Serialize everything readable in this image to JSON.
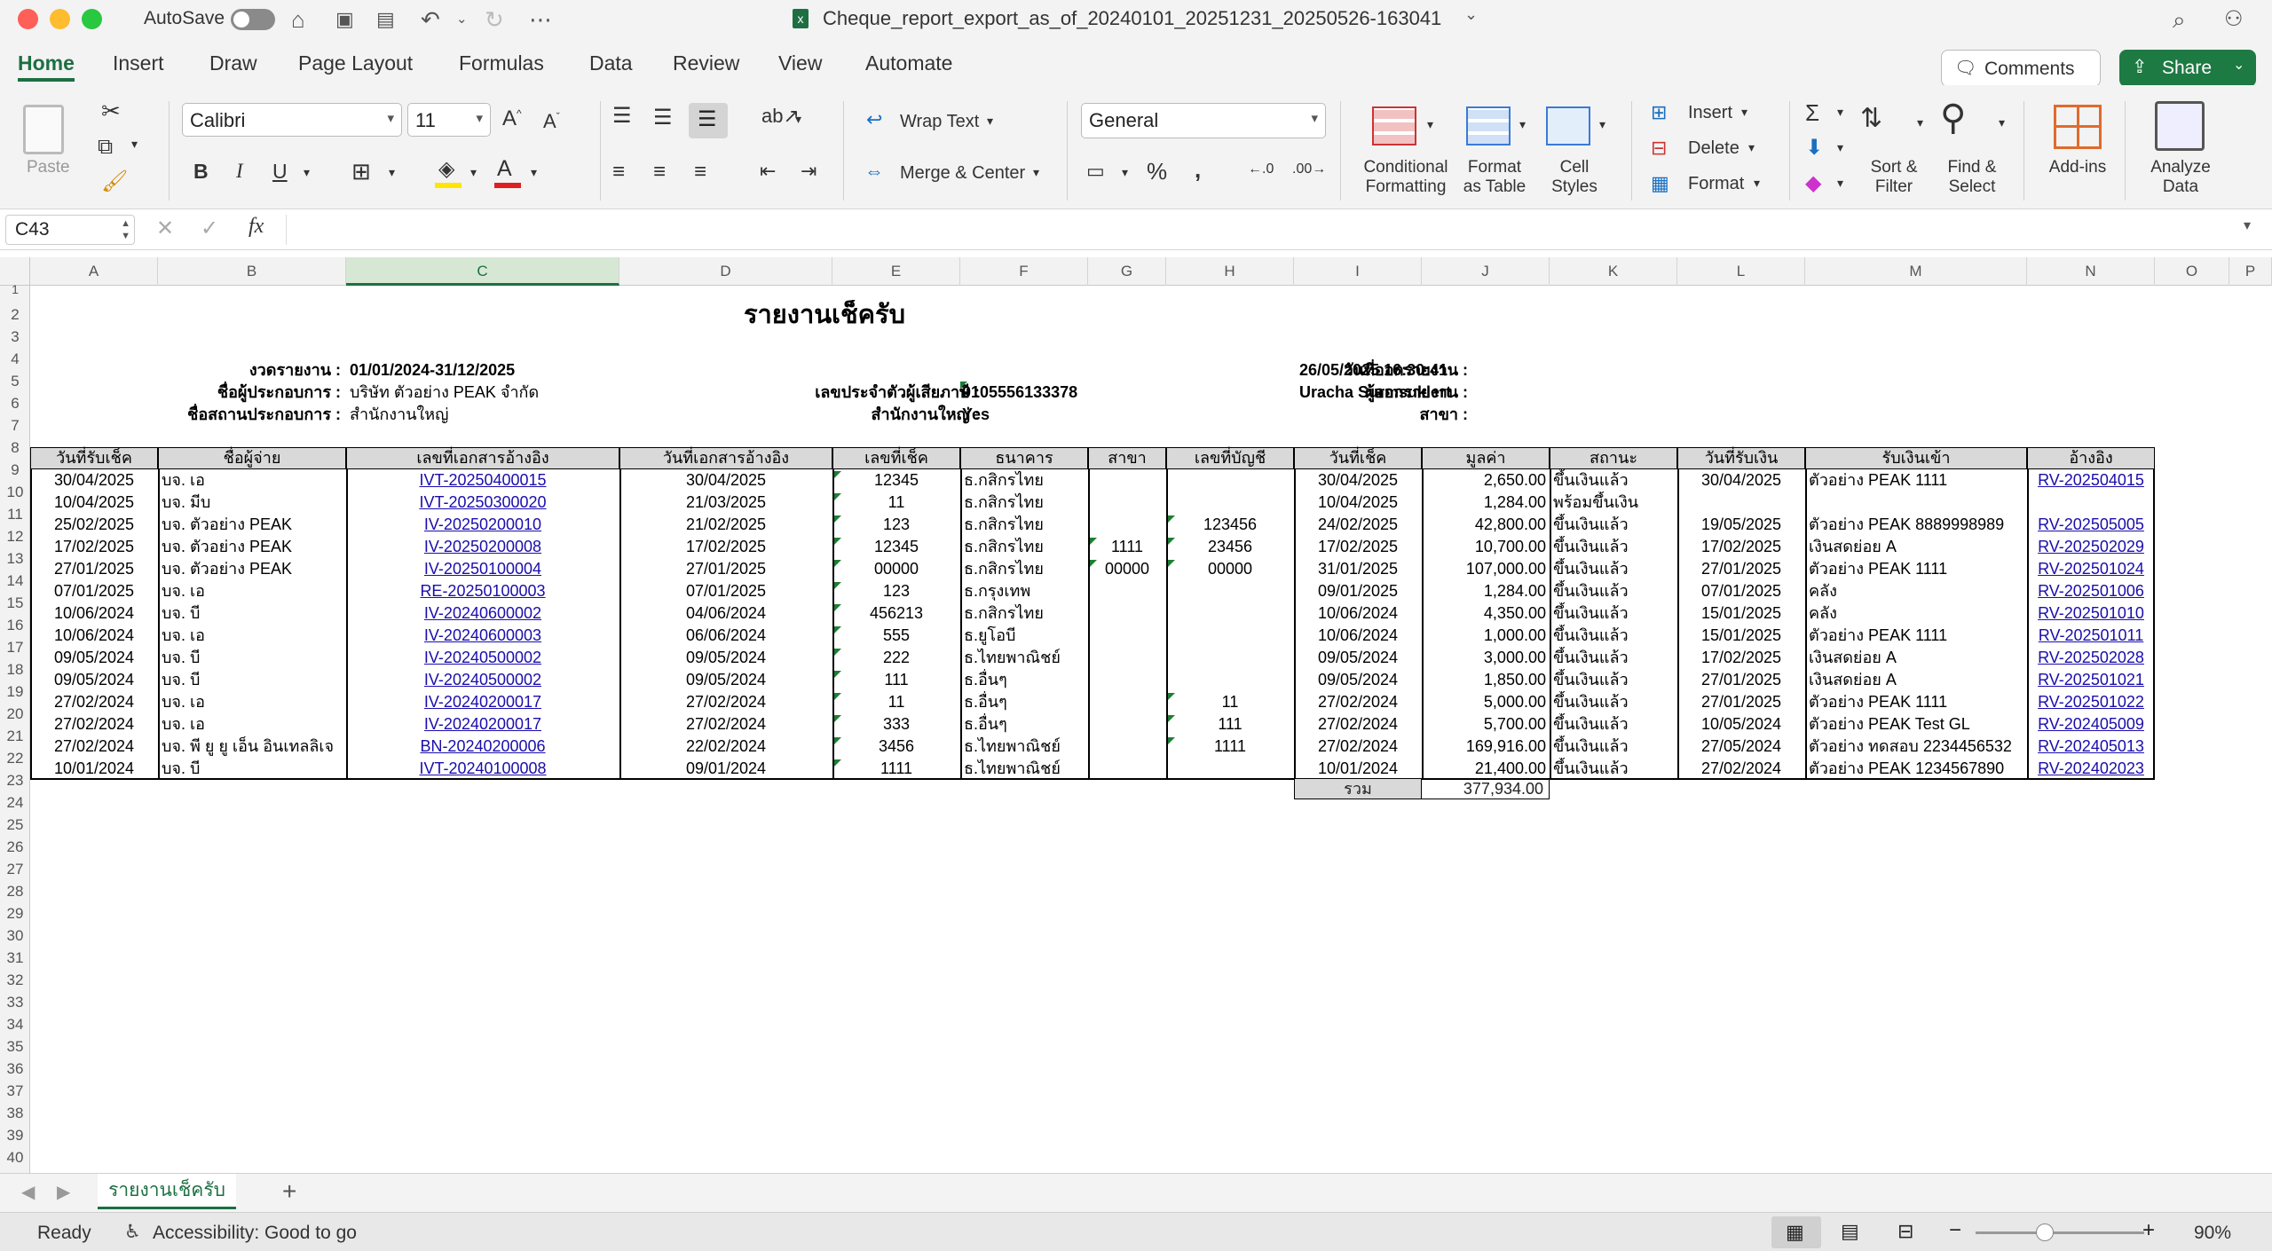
{
  "titlebar": {
    "autosave_label": "AutoSave",
    "filename": "Cheque_report_export_as_of_20240101_20251231_20250526-163041"
  },
  "tabs": [
    "Home",
    "Insert",
    "Draw",
    "Page Layout",
    "Formulas",
    "Data",
    "Review",
    "View",
    "Automate"
  ],
  "comments_label": "Comments",
  "share_label": "Share",
  "ribbon": {
    "paste": "Paste",
    "font_name": "Calibri",
    "font_size": "11",
    "wrap_text": "Wrap Text",
    "merge_center": "Merge & Center",
    "number_format": "General",
    "conditional_formatting": [
      "Conditional",
      "Formatting"
    ],
    "format_as_table": [
      "Format",
      "as Table"
    ],
    "cell_styles": [
      "Cell",
      "Styles"
    ],
    "insert": "Insert",
    "delete": "Delete",
    "format": "Format",
    "sort_filter": [
      "Sort &",
      "Filter"
    ],
    "find_select": [
      "Find &",
      "Select"
    ],
    "addins": "Add-ins",
    "analyze_data": [
      "Analyze",
      "Data"
    ]
  },
  "formula_bar": {
    "name_box": "C43",
    "fx": "fx",
    "formula": ""
  },
  "columns": [
    "A",
    "B",
    "C",
    "D",
    "E",
    "F",
    "G",
    "H",
    "I",
    "J",
    "K",
    "L",
    "M",
    "N",
    "O",
    "P"
  ],
  "rows": [
    "1",
    "2",
    "3",
    "4",
    "5",
    "6",
    "7",
    "8",
    "9",
    "10",
    "11",
    "12",
    "13",
    "14",
    "15",
    "16",
    "17",
    "18",
    "19",
    "20",
    "21",
    "22",
    "23",
    "24",
    "25",
    "26",
    "27",
    "28",
    "29",
    "30",
    "31",
    "32",
    "33",
    "34",
    "35",
    "36",
    "37",
    "38",
    "39",
    "40"
  ],
  "report": {
    "title": "รายงานเช็ครับ",
    "period_label": "งวดรายงาน :",
    "period_value": "01/01/2024-31/12/2025",
    "company_label": "ชื่อผู้ประกอบการ :",
    "company_value": "บริษัท ตัวอย่าง PEAK จำกัด",
    "branch_label": "ชื่อสถานประกอบการ :",
    "branch_value": "สำนักงานใหญ่",
    "taxid_label": "เลขประจำตัวผู้เสียภาษี :",
    "taxid_value": "0105556133378",
    "hq_label": "สำนักงานใหญ่ :",
    "hq_value": "Yes",
    "issue_date_label": "วันที่ออกรายงาน :",
    "issue_date_value": "26/05/2025 16:30:41",
    "issuer_label": "ผู้ออกรายงาน :",
    "issuer_value": "Uracha Surmsuklert",
    "branch2_label": "สาขา :"
  },
  "table_headers": [
    "วันที่รับเช็ค",
    "ชื่อผู้จ่าย",
    "เลขที่เอกสารอ้างอิง",
    "วันที่เอกสารอ้างอิง",
    "เลขที่เช็ค",
    "ธนาคาร",
    "สาขา",
    "เลขที่บัญชี",
    "วันที่เช็ค",
    "มูลค่า",
    "สถานะ",
    "วันที่รับเงิน",
    "รับเงินเข้า",
    "อ้างอิง"
  ],
  "table_rows": [
    [
      "30/04/2025",
      "บจ. เอ",
      "IVT-20250400015",
      "30/04/2025",
      "12345",
      "ธ.กสิกรไทย",
      "",
      "",
      "30/04/2025",
      "2,650.00",
      "ขึ้นเงินแล้ว",
      "30/04/2025",
      "ตัวอย่าง PEAK  1111",
      "RV-202504015"
    ],
    [
      "10/04/2025",
      "บจ. มีบ",
      "IVT-20250300020",
      "21/03/2025",
      "11",
      "ธ.กสิกรไทย",
      "",
      "",
      "10/04/2025",
      "1,284.00",
      "พร้อมขึ้นเงิน",
      "",
      "",
      ""
    ],
    [
      "25/02/2025",
      "บจ. ตัวอย่าง PEAK",
      "IV-20250200010",
      "21/02/2025",
      "123",
      "ธ.กสิกรไทย",
      "",
      "123456",
      "24/02/2025",
      "42,800.00",
      "ขึ้นเงินแล้ว",
      "19/05/2025",
      "ตัวอย่าง PEAK  8889998989",
      "RV-202505005"
    ],
    [
      "17/02/2025",
      "บจ. ตัวอย่าง PEAK",
      "IV-20250200008",
      "17/02/2025",
      "12345",
      "ธ.กสิกรไทย",
      "1111",
      "23456",
      "17/02/2025",
      "10,700.00",
      "ขึ้นเงินแล้ว",
      "17/02/2025",
      "เงินสดย่อย A",
      "RV-202502029"
    ],
    [
      "27/01/2025",
      "บจ. ตัวอย่าง PEAK",
      "IV-20250100004",
      "27/01/2025",
      "00000",
      "ธ.กสิกรไทย",
      "00000",
      "00000",
      "31/01/2025",
      "107,000.00",
      "ขึ้นเงินแล้ว",
      "27/01/2025",
      "ตัวอย่าง PEAK  1111",
      "RV-202501024"
    ],
    [
      "07/01/2025",
      "บจ. เอ",
      "RE-20250100003",
      "07/01/2025",
      "123",
      "ธ.กรุงเทพ",
      "",
      "",
      "09/01/2025",
      "1,284.00",
      "ขึ้นเงินแล้ว",
      "07/01/2025",
      "คลัง",
      "RV-202501006"
    ],
    [
      "10/06/2024",
      "บจ. บี",
      "IV-20240600002",
      "04/06/2024",
      "456213",
      "ธ.กสิกรไทย",
      "",
      "",
      "10/06/2024",
      "4,350.00",
      "ขึ้นเงินแล้ว",
      "15/01/2025",
      "คลัง",
      "RV-202501010"
    ],
    [
      "10/06/2024",
      "บจ. เอ",
      "IV-20240600003",
      "06/06/2024",
      "555",
      "ธ.ยูโอบี",
      "",
      "",
      "10/06/2024",
      "1,000.00",
      "ขึ้นเงินแล้ว",
      "15/01/2025",
      "ตัวอย่าง PEAK  1111",
      "RV-202501011"
    ],
    [
      "09/05/2024",
      "บจ. บี",
      "IV-20240500002",
      "09/05/2024",
      "222",
      "ธ.ไทยพาณิชย์",
      "",
      "",
      "09/05/2024",
      "3,000.00",
      "ขึ้นเงินแล้ว",
      "17/02/2025",
      "เงินสดย่อย A",
      "RV-202502028"
    ],
    [
      "09/05/2024",
      "บจ. บี",
      "IV-20240500002",
      "09/05/2024",
      "111",
      "ธ.อื่นๆ",
      "",
      "",
      "09/05/2024",
      "1,850.00",
      "ขึ้นเงินแล้ว",
      "27/01/2025",
      "เงินสดย่อย A",
      "RV-202501021"
    ],
    [
      "27/02/2024",
      "บจ. เอ",
      "IV-20240200017",
      "27/02/2024",
      "11",
      "ธ.อื่นๆ",
      "",
      "11",
      "27/02/2024",
      "5,000.00",
      "ขึ้นเงินแล้ว",
      "27/01/2025",
      "ตัวอย่าง PEAK  1111",
      "RV-202501022"
    ],
    [
      "27/02/2024",
      "บจ. เอ",
      "IV-20240200017",
      "27/02/2024",
      "333",
      "ธ.อื่นๆ",
      "",
      "111",
      "27/02/2024",
      "5,700.00",
      "ขึ้นเงินแล้ว",
      "10/05/2024",
      "ตัวอย่าง PEAK  Test GL",
      "RV-202405009"
    ],
    [
      "27/02/2024",
      "บจ. พี ยู ยู เอ็น อินเทลลิเจ",
      "BN-20240200006",
      "22/02/2024",
      "3456",
      "ธ.ไทยพาณิชย์",
      "",
      "1111",
      "27/02/2024",
      "169,916.00",
      "ขึ้นเงินแล้ว",
      "27/05/2024",
      "ตัวอย่าง ทดสอบ   2234456532",
      "RV-202405013"
    ],
    [
      "10/01/2024",
      "บจ. บี",
      "IVT-20240100008",
      "09/01/2024",
      "1111",
      "ธ.ไทยพาณิชย์",
      "",
      "",
      "10/01/2024",
      "21,400.00",
      "ขึ้นเงินแล้ว",
      "27/02/2024",
      "ตัวอย่าง PEAK  1234567890",
      "RV-202402023"
    ]
  ],
  "total_label": "รวม",
  "total_value": "377,934.00",
  "sheet_tab": "รายงานเช็ครับ",
  "status": {
    "ready": "Ready",
    "accessibility": "Accessibility: Good to go",
    "zoom": "90%"
  }
}
